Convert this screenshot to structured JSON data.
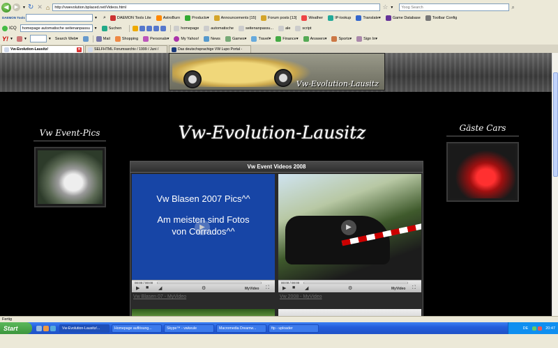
{
  "nav": {
    "url": "http://vwevolution.bplaced.net/Videos.html",
    "search_placeholder": "Yoog Search"
  },
  "daemon_bar": {
    "logo": "DAEMON Tools",
    "items": [
      "DAEMON Tools Lite",
      "AstroBurn",
      "Products",
      "Announcements [15]",
      "Forum posts [13]",
      "Weather",
      "IP-lookup",
      "Translate",
      "Game Database",
      "Toolbar Config"
    ]
  },
  "icq_bar": {
    "label": "ICQ",
    "field": "homepage automatische seitenanpassu",
    "search": "Suchen",
    "items": [
      "homepage",
      "automatische",
      "seitenanpassu...",
      "ale",
      "script"
    ]
  },
  "yahoo_bar": {
    "search_label": "Search Web",
    "items": [
      "Mail",
      "Shopping",
      "Personals",
      "My Yahoo!",
      "News",
      "Games",
      "Travel",
      "Finance",
      "Answers",
      "Sports",
      "Sign In"
    ]
  },
  "tabs": [
    {
      "label": "Vw-Evolution-Lausitz/",
      "active": true
    },
    {
      "label": "SELFHTML Forumsarchiv / 1999 / Juni /",
      "active": false
    },
    {
      "label": "Das deutschsprachige VW Lupo Portal -",
      "active": false
    }
  ],
  "page": {
    "banner_text": "Vw-Evolution-Lausitz",
    "title": "Vw-Evolution-Lausitz",
    "left_heading": "Vw Event-Pics",
    "right_heading": "Gäste Cars",
    "videos_title": "Vw Event Videos 2008",
    "videos": [
      {
        "screen_text": [
          "Vw Blasen 2007 Pics^^",
          "Am meisten sind Fotos",
          "von Corrados^^"
        ],
        "time": "00:00 / 00:00",
        "link": "Vw Blasen 07 - MyVideo",
        "brand": "MyVideo"
      },
      {
        "screen_text": [],
        "time": "00:00 / 00:00",
        "link": "Vw 2008 - MyVideo",
        "brand": "MyVideo"
      }
    ]
  },
  "status": {
    "text": "Fertig"
  },
  "taskbar": {
    "start": "Start",
    "tasks": [
      "Vw-Evolution-Lausitz/...",
      "Homepage auflösung...",
      "Skype™ - vwkeule",
      "Macromedia Dreamw...",
      "ftp - uploader"
    ],
    "lang": "DE",
    "clock": "20:47"
  }
}
